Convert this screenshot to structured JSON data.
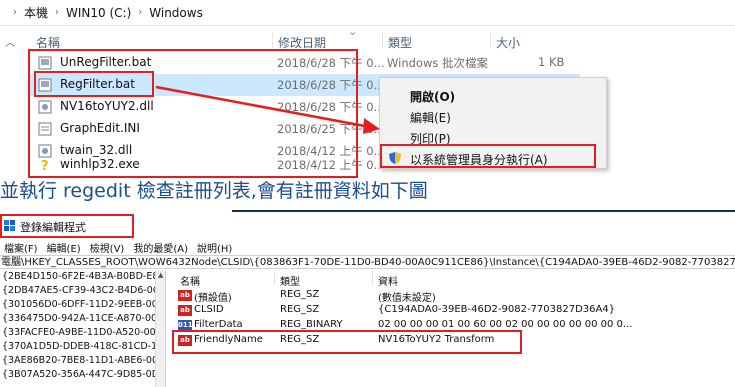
{
  "explorer": {
    "breadcrumb": [
      "本機",
      "WIN10 (C:)",
      "Windows"
    ],
    "columns": {
      "name": "名稱",
      "modified": "修改日期",
      "type": "類型",
      "size": "大小"
    },
    "files": [
      {
        "name": "UnRegFilter.bat",
        "date": "2018/6/28 下午 0...",
        "type": "Windows 批次檔案",
        "size": "1 KB",
        "icon": "bat-file-icon"
      },
      {
        "name": "RegFilter.bat",
        "date": "2018/6/28 下午 0...",
        "type": "",
        "size": "",
        "icon": "bat-file-icon",
        "selected": true
      },
      {
        "name": "NV16toYUY2.dll",
        "date": "2018/6/28 下午 0...",
        "type": "",
        "size": "",
        "icon": "dll-file-icon"
      },
      {
        "name": "GraphEdit.INI",
        "date": "2018/6/25 下午 0...",
        "type": "",
        "size": "",
        "icon": "ini-file-icon"
      },
      {
        "name": "twain_32.dll",
        "date": "2018/4/12 上午 0...",
        "type": "",
        "size": "",
        "icon": "dll-file-icon"
      },
      {
        "name": "winhlp32.exe",
        "date": "2018/4/12 上午 0...",
        "type": "",
        "size": "",
        "icon": "help-exe-icon"
      }
    ]
  },
  "context_menu": {
    "items": [
      "開啟(O)",
      "編輯(E)",
      "列印(P)",
      "以系統管理員身分執行(A)"
    ]
  },
  "caption": "並執行 regedit 檢查註冊列表,會有註冊資料如下圖",
  "regedit": {
    "title": "登錄編輯程式",
    "menu": [
      "檔案(F)",
      "編輯(E)",
      "檢視(V)",
      "我的最愛(A)",
      "說明(H)"
    ],
    "address": "電腦\\HKEY_CLASSES_ROOT\\WOW6432Node\\CLSID\\{083863F1-70DE-11D0-BD40-00A0C911CE86}\\Instance\\{C194ADA0-39EB-46D2-9082-7703827D36A4}",
    "tree": [
      "{2BE4D150-6F2E-4B3A-B0BD-E88C",
      "{2DB47AE5-CF39-43C2-B4D6-0CD",
      "{301056D0-6DFF-11D2-9EEB-006C",
      "{336475D0-942A-11CE-A870-00A",
      "{33FACFE0-A9BE-11D0-A520-00A",
      "{370A1D5D-DDEB-418C-81CD-189",
      "{3AE86B20-7BE8-11D1-ABE6-00A",
      "{3B07A520-356A-447C-9D85-0D"
    ],
    "columns": {
      "name": "名稱",
      "type": "類型",
      "data": "資料"
    },
    "values": [
      {
        "name": "(預設值)",
        "type": "REG_SZ",
        "data": "(數值未設定)",
        "icon": "reg-string-icon"
      },
      {
        "name": "CLSID",
        "type": "REG_SZ",
        "data": "{C194ADA0-39EB-46D2-9082-7703827D36A4}",
        "icon": "reg-string-icon"
      },
      {
        "name": "FilterData",
        "type": "REG_BINARY",
        "data": "02 00 00 00 01 00 60 00 02 00 00 00 00 00 00 0...",
        "icon": "reg-binary-icon"
      },
      {
        "name": "FriendlyName",
        "type": "REG_SZ",
        "data": "NV16ToYUY2 Transform",
        "icon": "reg-string-icon"
      }
    ]
  },
  "colors": {
    "highlight_red": "#e02020",
    "selection": "#cce8ff",
    "caption_blue": "#1a4e8c"
  }
}
